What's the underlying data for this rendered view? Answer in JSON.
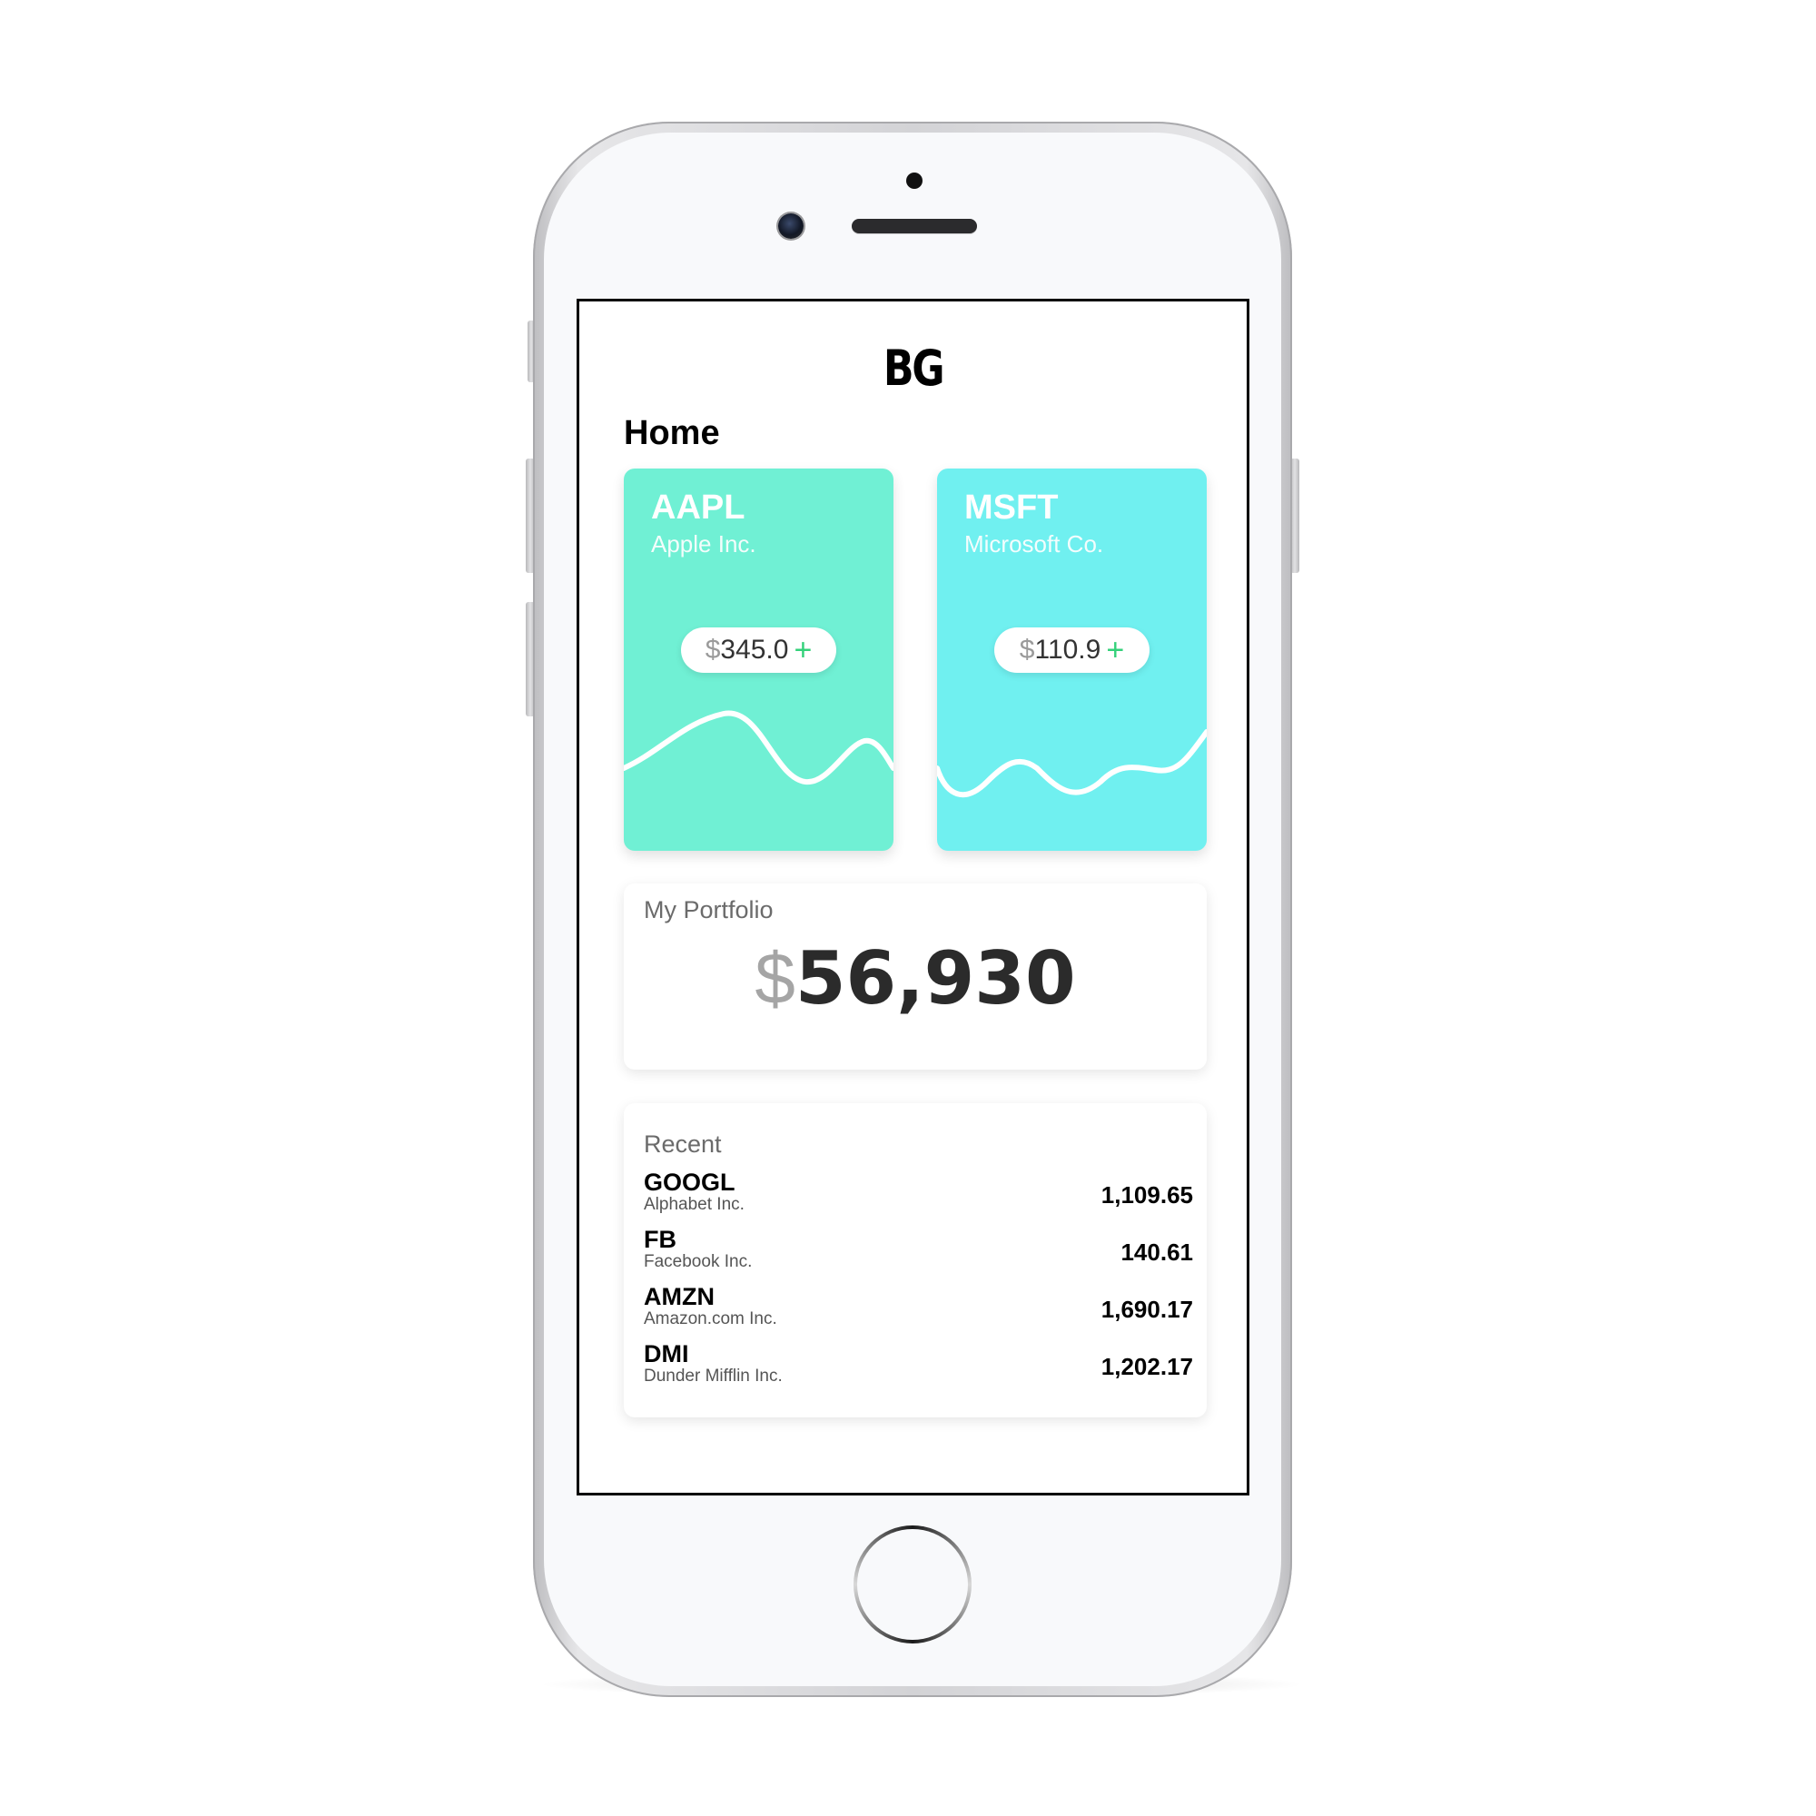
{
  "app": {
    "logo": "BG",
    "page_title": "Home"
  },
  "stocks": [
    {
      "ticker": "AAPL",
      "company": "Apple Inc.",
      "currency": "$",
      "price": "345.0",
      "change_symbol": "+",
      "color": "#70f0d4"
    },
    {
      "ticker": "MSFT",
      "company": "Microsoft Co.",
      "currency": "$",
      "price": "110.9",
      "change_symbol": "+",
      "color": "#70f0f0"
    }
  ],
  "portfolio": {
    "label": "My Portfolio",
    "currency": "$",
    "value": "56,930"
  },
  "recent": {
    "title": "Recent",
    "items": [
      {
        "ticker": "GOOGL",
        "company": "Alphabet Inc.",
        "value": "1,109.65"
      },
      {
        "ticker": "FB",
        "company": "Facebook Inc.",
        "value": "140.61"
      },
      {
        "ticker": "AMZN",
        "company": "Amazon.com Inc.",
        "value": "1,690.17"
      },
      {
        "ticker": "DMI",
        "company": "Dunder Mifflin Inc.",
        "value": "1,202.17"
      }
    ]
  },
  "colors": {
    "positive": "#34d17a",
    "aapl_card": "#70f0d4",
    "msft_card": "#70f0f0"
  }
}
